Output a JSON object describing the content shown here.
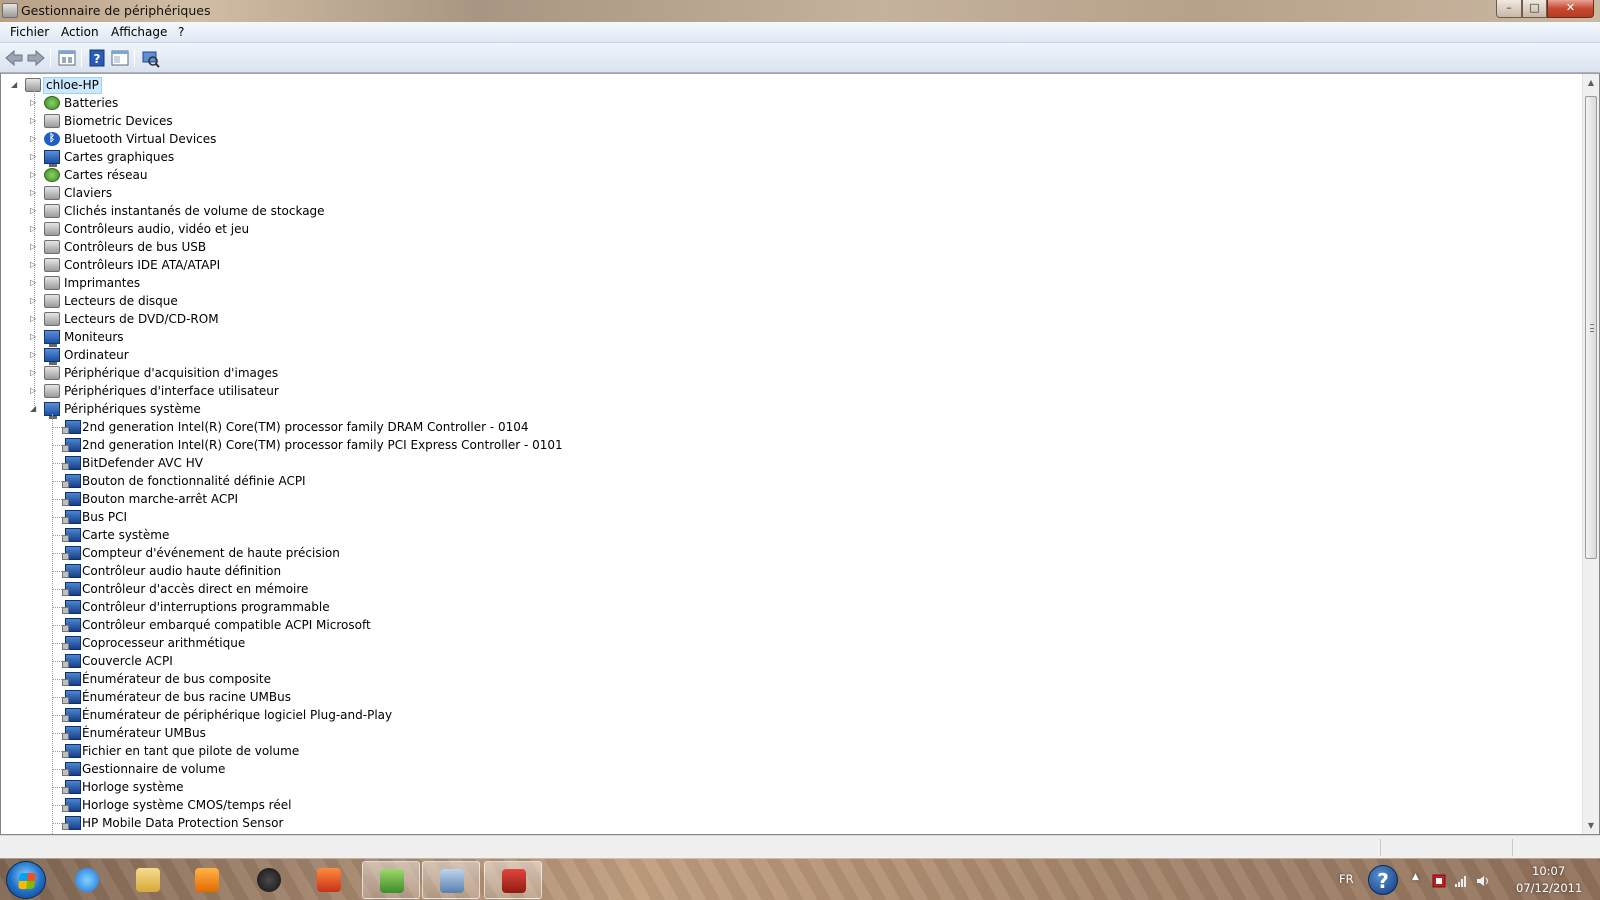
{
  "window": {
    "title": "Gestionnaire de périphériques",
    "controls": {
      "minimize": "–",
      "maximize": "□",
      "close": "✕"
    }
  },
  "menu": [
    "Fichier",
    "Action",
    "Affichage",
    "?"
  ],
  "toolbar": [
    "back-icon",
    "forward-icon",
    "properties-icon",
    "help-icon",
    "panel-icon",
    "scan-hardware-icon"
  ],
  "tree": {
    "root": "chloe-HP",
    "categories": [
      {
        "label": "Batteries",
        "icon": "battery-icon"
      },
      {
        "label": "Biometric Devices",
        "icon": "biometric-icon"
      },
      {
        "label": "Bluetooth Virtual Devices",
        "icon": "bluetooth-icon"
      },
      {
        "label": "Cartes graphiques",
        "icon": "display-adapter-icon"
      },
      {
        "label": "Cartes réseau",
        "icon": "network-adapter-icon"
      },
      {
        "label": "Claviers",
        "icon": "keyboard-icon"
      },
      {
        "label": "Clichés instantanés de volume de stockage",
        "icon": "storage-icon"
      },
      {
        "label": "Contrôleurs audio, vidéo et jeu",
        "icon": "audio-icon"
      },
      {
        "label": "Contrôleurs de bus USB",
        "icon": "usb-icon"
      },
      {
        "label": "Contrôleurs IDE ATA/ATAPI",
        "icon": "ide-icon"
      },
      {
        "label": "Imprimantes",
        "icon": "printer-icon"
      },
      {
        "label": "Lecteurs de disque",
        "icon": "disk-icon"
      },
      {
        "label": "Lecteurs de DVD/CD-ROM",
        "icon": "dvd-icon"
      },
      {
        "label": "Moniteurs",
        "icon": "monitor-icon"
      },
      {
        "label": "Ordinateur",
        "icon": "computer-icon"
      },
      {
        "label": "Périphérique d'acquisition d'images",
        "icon": "camera-icon"
      },
      {
        "label": "Périphériques d'interface utilisateur",
        "icon": "hid-icon"
      },
      {
        "label": "Périphériques système",
        "icon": "system-icon",
        "expanded": true
      }
    ],
    "system_devices": [
      "2nd generation Intel(R) Core(TM) processor family DRAM Controller - 0104",
      "2nd generation Intel(R) Core(TM) processor family PCI Express Controller - 0101",
      "BitDefender AVC HV",
      "Bouton de fonctionnalité définie ACPI",
      "Bouton marche-arrêt ACPI",
      "Bus PCI",
      "Carte système",
      "Compteur d'événement de haute précision",
      "Contrôleur audio haute définition",
      "Contrôleur d'accès direct en mémoire",
      "Contrôleur d'interruptions programmable",
      "Contrôleur embarqué compatible ACPI Microsoft",
      "Coprocesseur arithmétique",
      "Couvercle ACPI",
      "Énumérateur de bus composite",
      "Énumérateur de bus racine UMBus",
      "Énumérateur de périphérique logiciel Plug-and-Play",
      "Énumérateur UMBus",
      "Fichier en tant que pilote de volume",
      "Gestionnaire de volume",
      "Horloge système",
      "Horloge système CMOS/temps réel",
      "HP Mobile Data Protection Sensor"
    ]
  },
  "taskbar": {
    "apps": [
      "internet-explorer-icon",
      "explorer-folder-icon",
      "media-player-icon",
      "hp-icon",
      "office-icon",
      "users-icon",
      "device-manager-icon",
      "toolbox-icon"
    ],
    "language": "FR",
    "time": "10:07",
    "date": "07/12/2011"
  },
  "colors": {
    "selection": "#cce8ff",
    "taskbar_tint": "#8a6a55"
  }
}
